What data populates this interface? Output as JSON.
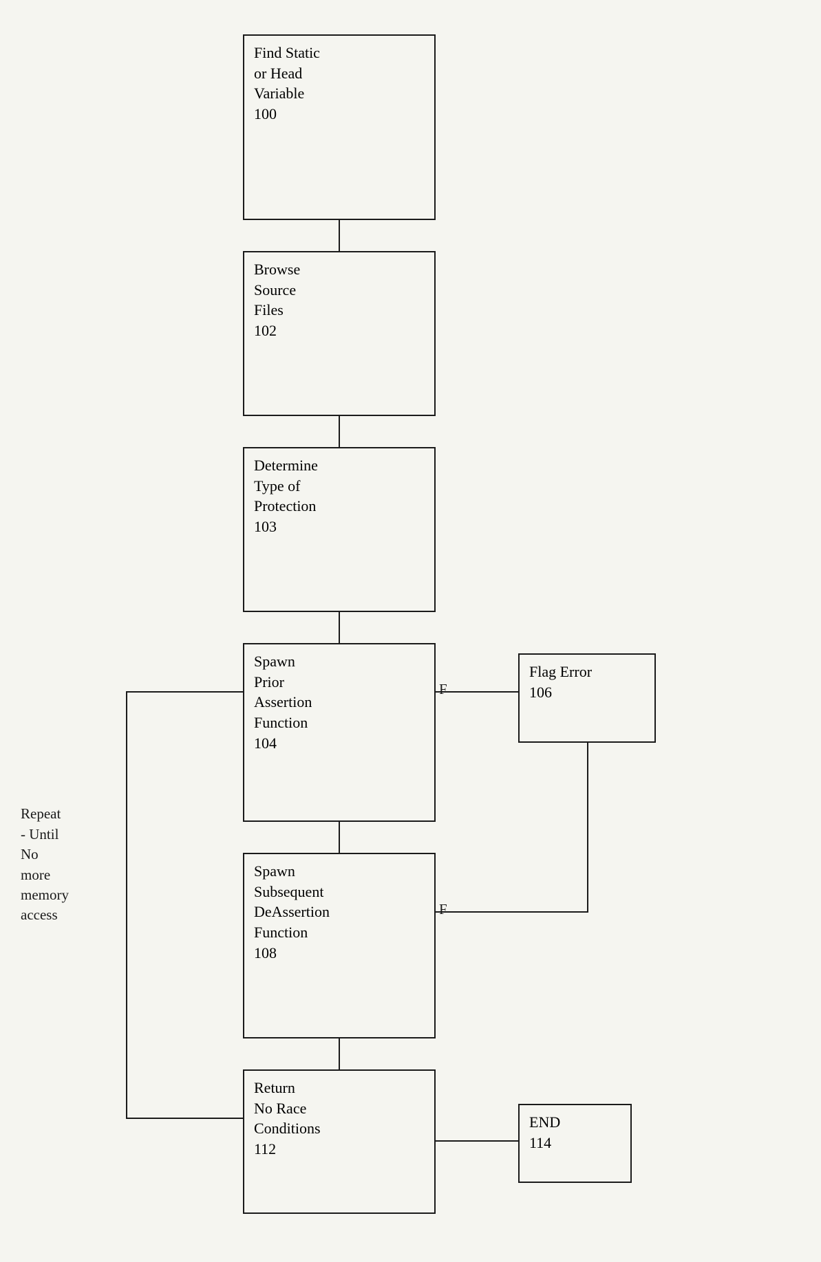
{
  "boxes": {
    "find_static": {
      "label": "Find Static\nor Head\nVariable\n100",
      "id": "find-static-box"
    },
    "browse_source": {
      "label": "Browse\nSource\nFiles\n102",
      "id": "browse-source-box"
    },
    "determine_type": {
      "label": "Determine\nType of\nProtection\n103",
      "id": "determine-type-box"
    },
    "spawn_prior": {
      "label": "Spawn\nPrior\nAssertion\nFunction\n104",
      "id": "spawn-prior-box"
    },
    "flag_error": {
      "label": "Flag Error\n106",
      "id": "flag-error-box"
    },
    "spawn_subsequent": {
      "label": "Spawn\nSubsequent\nDeAssertion\nFunction\n108",
      "id": "spawn-subsequent-box"
    },
    "return_no_race": {
      "label": "Return\nNo Race\nConditions\n112",
      "id": "return-no-race-box"
    },
    "end": {
      "label": "END\n114",
      "id": "end-box"
    }
  },
  "labels": {
    "repeat_until": "Repeat\n- Until\nNo\nmore\nmemory\naccess",
    "f1": "F",
    "f2": "F"
  },
  "colors": {
    "border": "#1a1a1a",
    "bg": "#f5f5f0",
    "text": "#1a1a1a"
  }
}
